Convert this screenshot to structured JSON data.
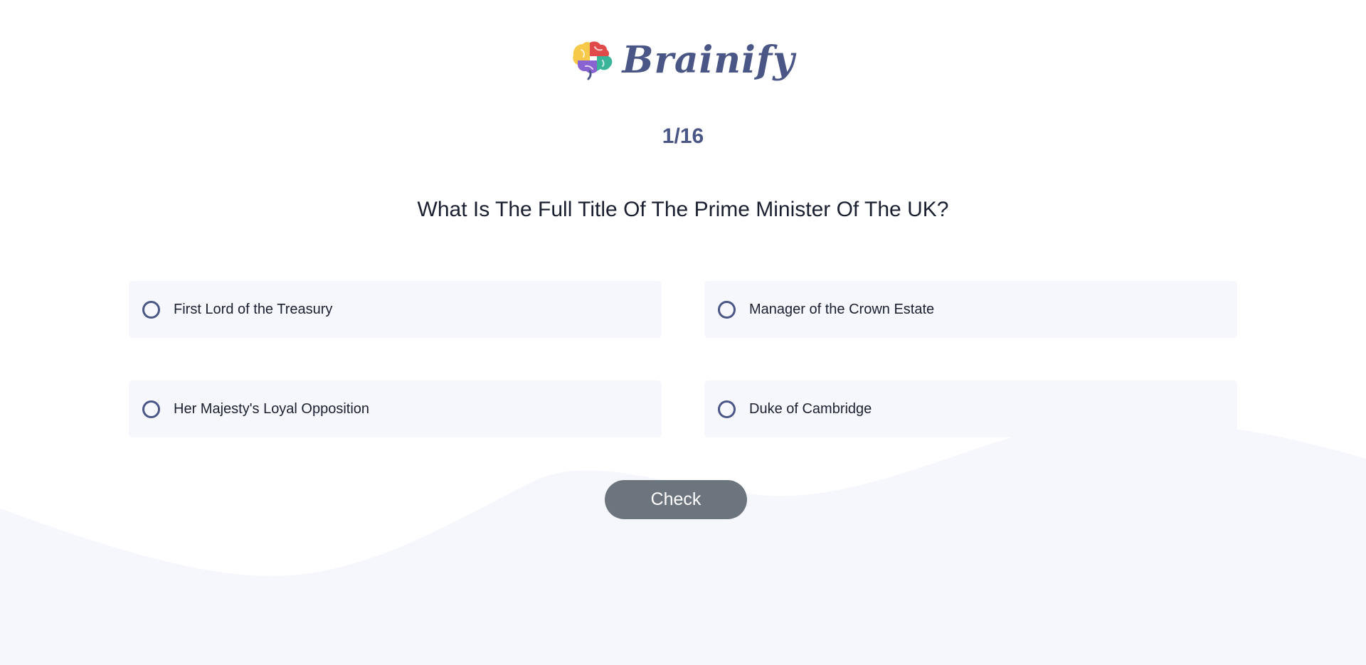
{
  "brand": {
    "name": "Brainify",
    "logo_icon": "brain-icon",
    "text_color": "#4a5685"
  },
  "progress": {
    "label": "1/16"
  },
  "question": {
    "text": "What Is The Full Title Of The Prime Minister Of The UK?"
  },
  "options": [
    {
      "label": "First Lord of the Treasury"
    },
    {
      "label": "Manager of the Crown Estate"
    },
    {
      "label": "Her Majesty's Loyal Opposition"
    },
    {
      "label": "Duke of Cambridge"
    }
  ],
  "check_button": {
    "label": "Check",
    "color": "#6c757d"
  },
  "colors": {
    "accent": "#4a5685",
    "option_background": "#f6f7fc",
    "text": "#1b2030",
    "wave": "#f6f7fc"
  }
}
